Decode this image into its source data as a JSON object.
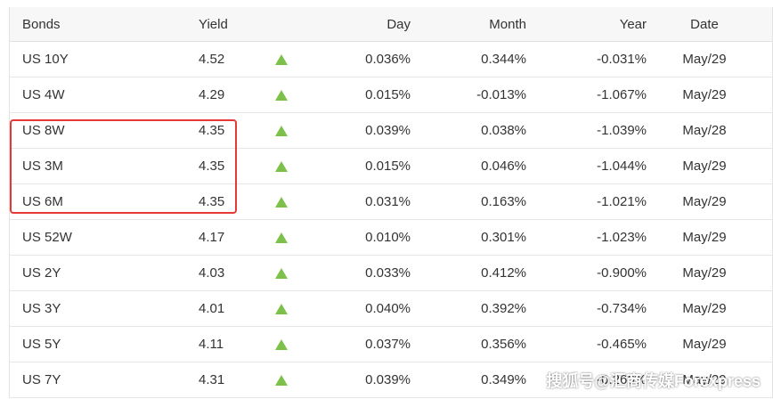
{
  "colors": {
    "up_arrow": "#7cc24a",
    "highlight_border": "#e53935",
    "header_bg": "#f7f7f7"
  },
  "header": {
    "bonds": "Bonds",
    "yield": "Yield",
    "day": "Day",
    "month": "Month",
    "year": "Year",
    "date": "Date"
  },
  "rows": [
    {
      "name": "US 10Y",
      "yield": "4.52",
      "day": "0.036%",
      "month": "0.344%",
      "year": "-0.031%",
      "date": "May/29",
      "direction": "up-arrow-icon"
    },
    {
      "name": "US 4W",
      "yield": "4.29",
      "day": "0.015%",
      "month": "-0.013%",
      "year": "-1.067%",
      "date": "May/29",
      "direction": "up-arrow-icon"
    },
    {
      "name": "US 8W",
      "yield": "4.35",
      "day": "0.039%",
      "month": "0.038%",
      "year": "-1.039%",
      "date": "May/28",
      "direction": "up-arrow-icon"
    },
    {
      "name": "US 3M",
      "yield": "4.35",
      "day": "0.015%",
      "month": "0.046%",
      "year": "-1.044%",
      "date": "May/29",
      "direction": "up-arrow-icon"
    },
    {
      "name": "US 6M",
      "yield": "4.35",
      "day": "0.031%",
      "month": "0.163%",
      "year": "-1.021%",
      "date": "May/29",
      "direction": "up-arrow-icon"
    },
    {
      "name": "US 52W",
      "yield": "4.17",
      "day": "0.010%",
      "month": "0.301%",
      "year": "-1.023%",
      "date": "May/29",
      "direction": "up-arrow-icon"
    },
    {
      "name": "US 2Y",
      "yield": "4.03",
      "day": "0.033%",
      "month": "0.412%",
      "year": "-0.900%",
      "date": "May/29",
      "direction": "up-arrow-icon"
    },
    {
      "name": "US 3Y",
      "yield": "4.01",
      "day": "0.040%",
      "month": "0.392%",
      "year": "-0.734%",
      "date": "May/29",
      "direction": "up-arrow-icon"
    },
    {
      "name": "US 5Y",
      "yield": "4.11",
      "day": "0.037%",
      "month": "0.356%",
      "year": "-0.465%",
      "date": "May/29",
      "direction": "up-arrow-icon"
    },
    {
      "name": "US 7Y",
      "yield": "4.31",
      "day": "0.039%",
      "month": "0.349%",
      "year": "-0.266%",
      "date": "May/29",
      "direction": "up-arrow-icon"
    }
  ],
  "watermark": "搜狐号@汇商传媒Forexpress"
}
